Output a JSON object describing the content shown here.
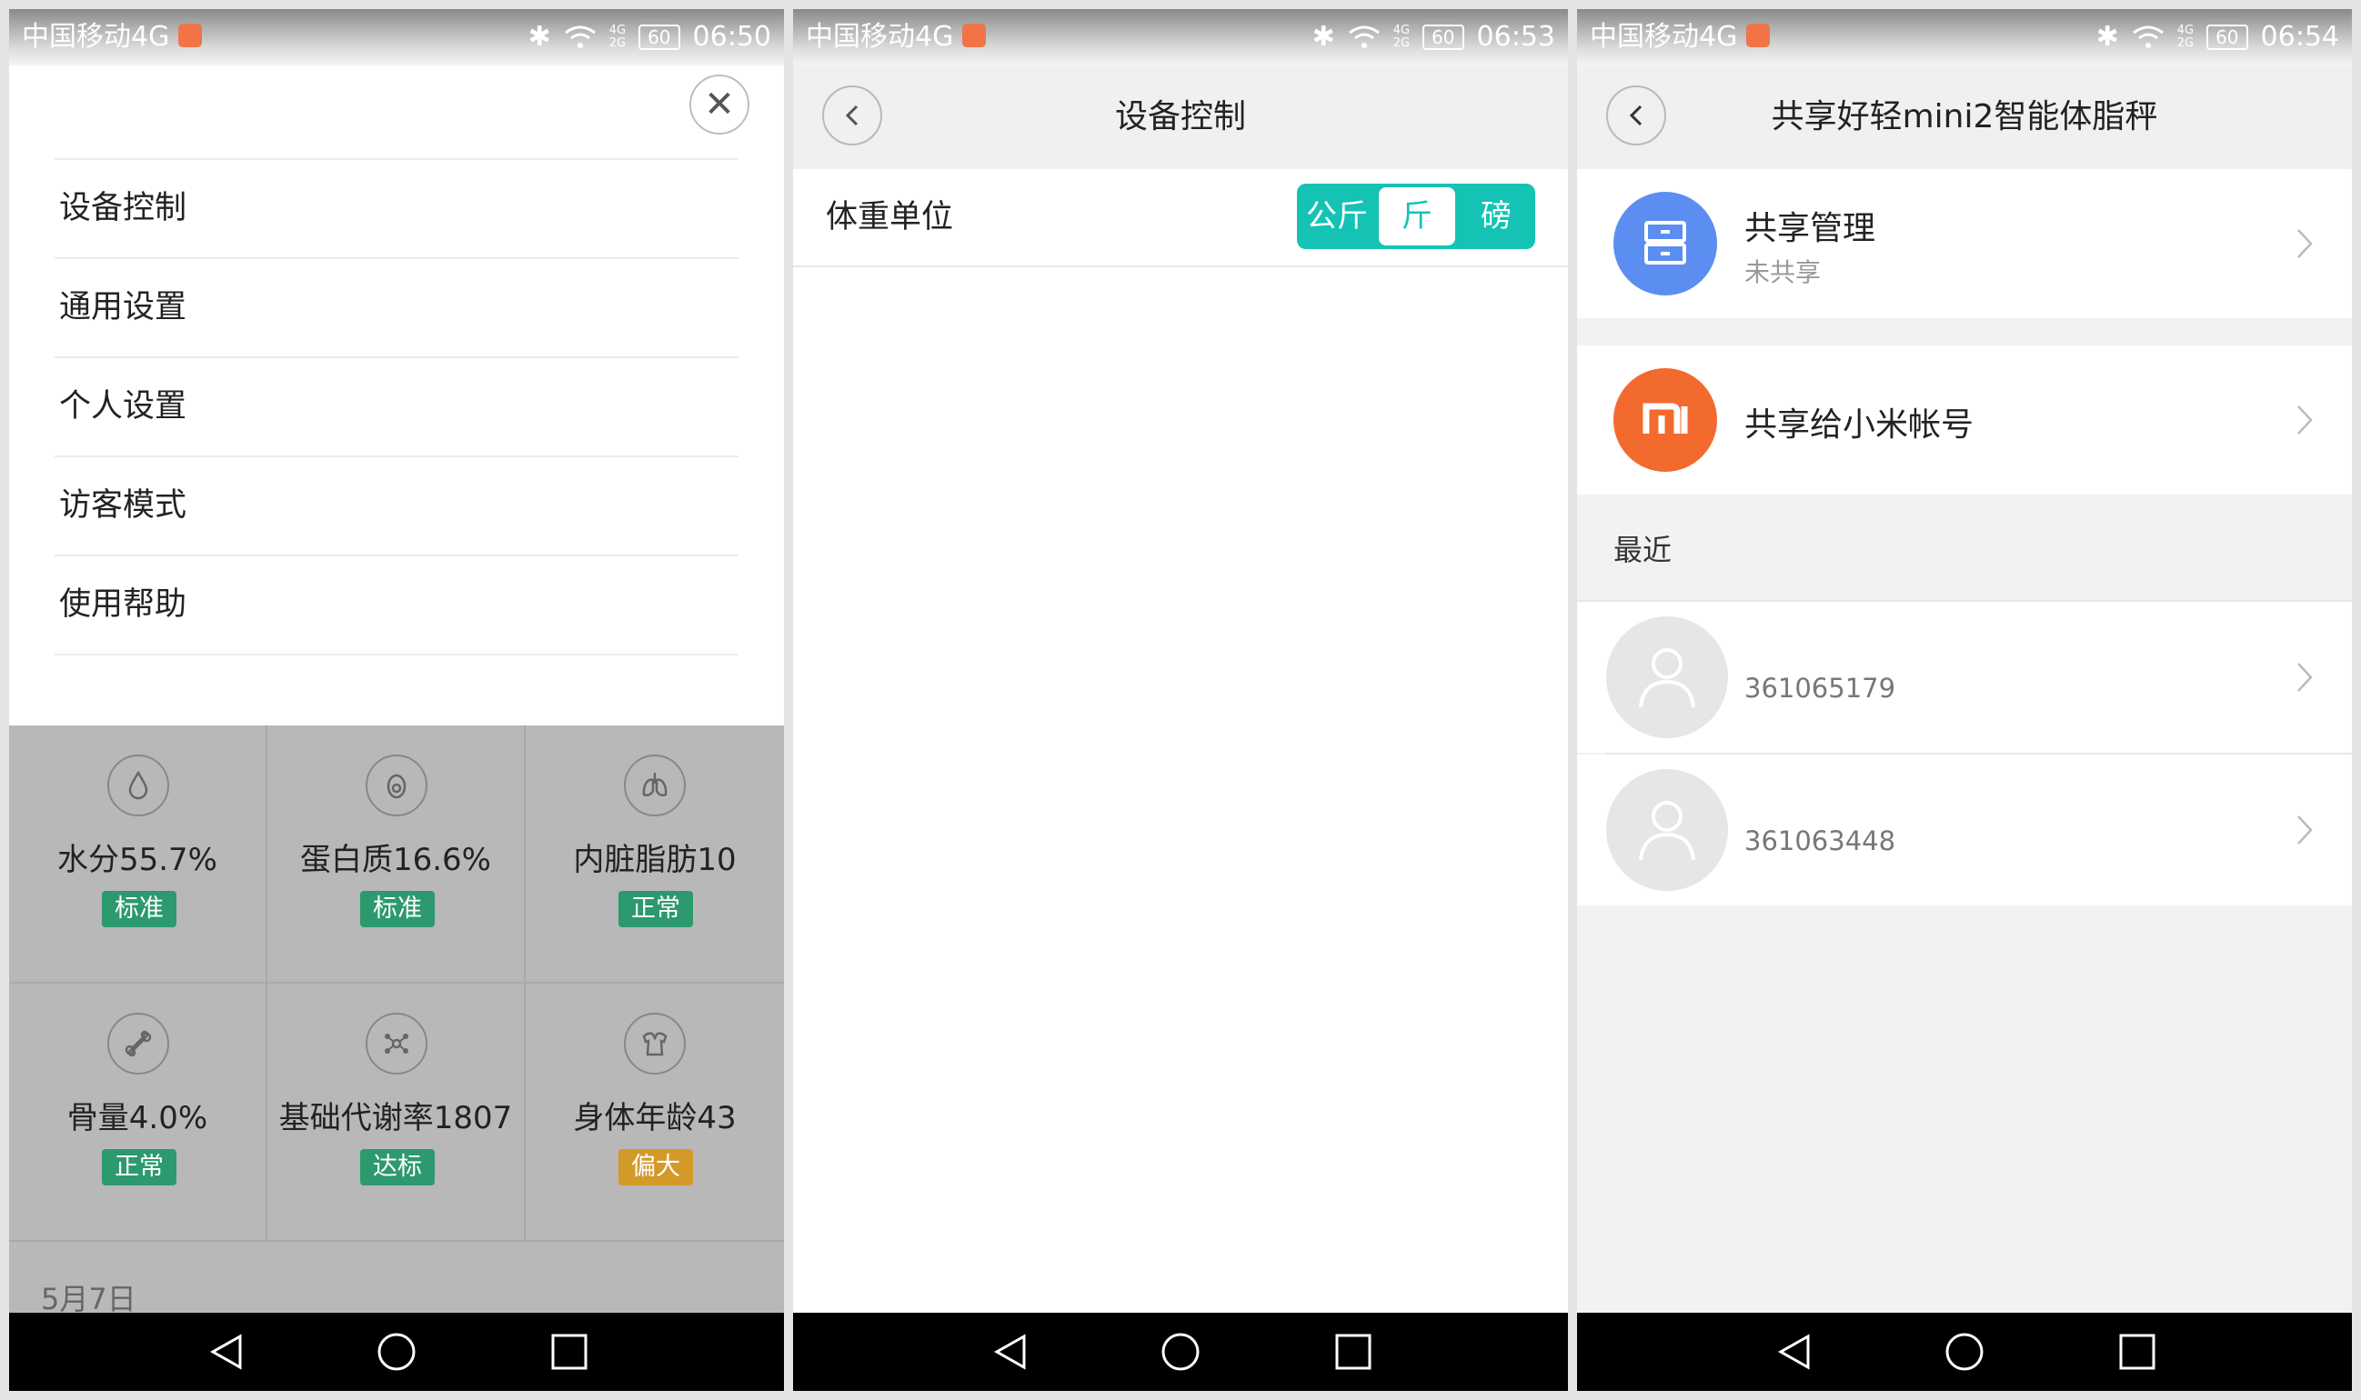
{
  "colors": {
    "teal_accent": "#14c3b4",
    "badge_green": "#2c9a6e",
    "badge_orange": "#d39a2a",
    "blue_avatar": "#5b8ef0",
    "orange_avatar": "#f26a2d"
  },
  "panels": [
    {
      "status": {
        "carrier": "中国移动4G",
        "net_top": "4G",
        "net_bottom": "2G",
        "battery": "60",
        "time": "06:50"
      },
      "menu": [
        {
          "label": "设备控制"
        },
        {
          "label": "通用设置"
        },
        {
          "label": "个人设置"
        },
        {
          "label": "访客模式"
        },
        {
          "label": "使用帮助"
        }
      ],
      "metrics": [
        {
          "value": "水分55.7%",
          "badge": "标准",
          "badge_color": "#2c9a6e",
          "icon": "water-drop-icon"
        },
        {
          "value": "蛋白质16.6%",
          "badge": "标准",
          "badge_color": "#2c9a6e",
          "icon": "egg-icon"
        },
        {
          "value": "内脏脂肪10",
          "badge": "正常",
          "badge_color": "#2c9a6e",
          "icon": "lungs-icon"
        },
        {
          "value": "骨量4.0%",
          "badge": "正常",
          "badge_color": "#2c9a6e",
          "icon": "bone-icon"
        },
        {
          "value": "基础代谢率1807",
          "badge": "达标",
          "badge_color": "#2c9a6e",
          "icon": "molecule-icon"
        },
        {
          "value": "身体年龄43",
          "badge": "偏大",
          "badge_color": "#d39a2a",
          "icon": "torso-icon"
        }
      ],
      "date": "5月7日"
    },
    {
      "status": {
        "carrier": "中国移动4G",
        "net_top": "4G",
        "net_bottom": "2G",
        "battery": "60",
        "time": "06:53"
      },
      "title": "设备控制",
      "unit_label": "体重单位",
      "unit_options": [
        "公斤",
        "斤",
        "磅"
      ],
      "unit_selected": "斤"
    },
    {
      "status": {
        "carrier": "中国移动4G",
        "net_top": "4G",
        "net_bottom": "2G",
        "battery": "60",
        "time": "06:54"
      },
      "title": "共享好轻mini2智能体脂秤",
      "share_manage": {
        "title": "共享管理",
        "subtitle": "未共享"
      },
      "share_mi": {
        "title": "共享给小米帐号",
        "logo_text": "mi"
      },
      "recent_label": "最近",
      "contacts": [
        {
          "id": "361065179"
        },
        {
          "id": "361063448"
        }
      ]
    }
  ]
}
